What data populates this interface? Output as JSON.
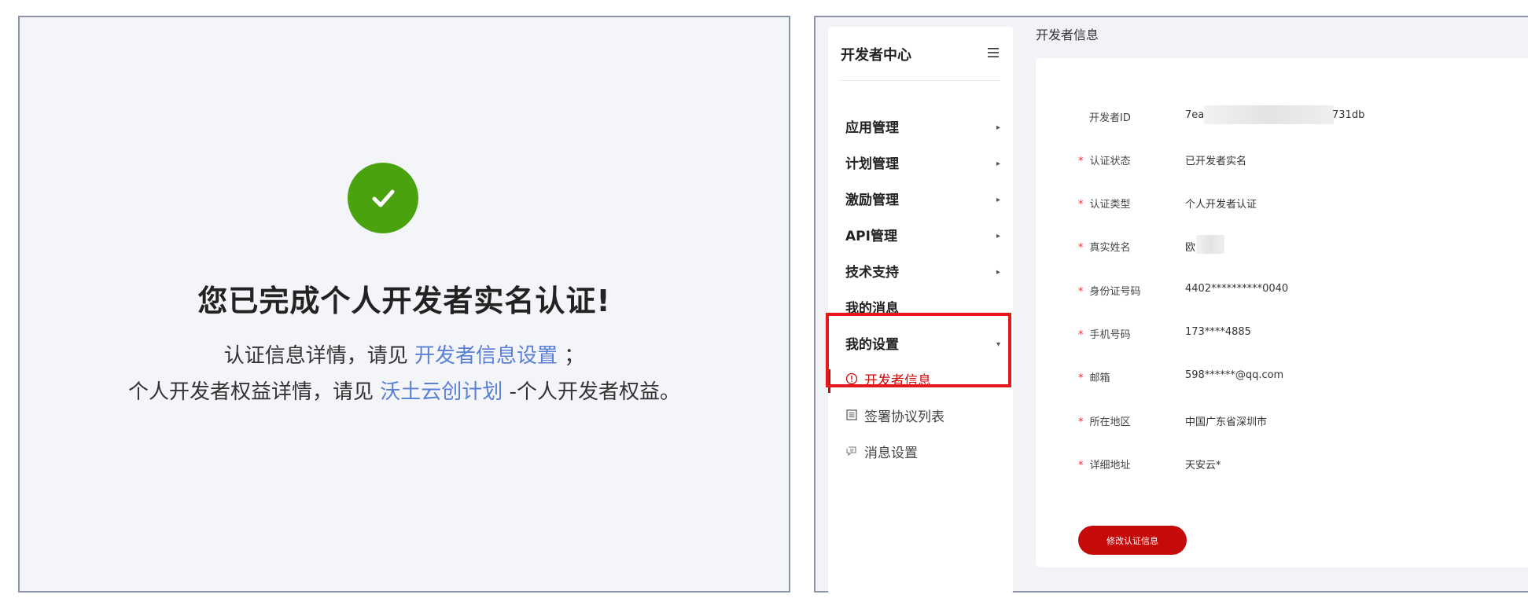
{
  "left": {
    "title": "您已完成个人开发者实名认证!",
    "line1_prefix": "认证信息详情，请见",
    "line1_link": "开发者信息设置",
    "line1_suffix": "；",
    "line2_prefix": "个人开发者权益详情，请见",
    "line2_link": "沃土云创计划",
    "line2_suffix": "-个人开发者权益。",
    "success_color": "#4aa20f",
    "link_color": "#5a7fd6"
  },
  "sidebar": {
    "title": "开发者中心",
    "items": [
      {
        "label": "应用管理",
        "arrow": "▸"
      },
      {
        "label": "计划管理",
        "arrow": "▸"
      },
      {
        "label": "激励管理",
        "arrow": "▸"
      },
      {
        "label": "API管理",
        "arrow": "▸"
      },
      {
        "label": "技术支持",
        "arrow": "▸"
      },
      {
        "label": "我的消息",
        "arrow": ""
      },
      {
        "label": "我的设置",
        "arrow": "▾"
      }
    ],
    "sub_items": [
      {
        "label": "开发者信息",
        "icon": "info-circle-icon",
        "active": true
      },
      {
        "label": "签署协议列表",
        "icon": "document-list-icon",
        "active": false
      },
      {
        "label": "消息设置",
        "icon": "message-icon",
        "active": false
      }
    ],
    "active_color": "#cc0a0a",
    "highlight_color": "#e4181d"
  },
  "content": {
    "breadcrumb": "开发者信息",
    "fields": [
      {
        "label": "开发者ID",
        "value": "7ea",
        "value_tail": "731db",
        "required": false
      },
      {
        "label": "认证状态",
        "value": "已开发者实名",
        "required": true
      },
      {
        "label": "认证类型",
        "value": "个人开发者认证",
        "required": true
      },
      {
        "label": "真实姓名",
        "value": "欧",
        "required": true
      },
      {
        "label": "身份证号码",
        "value": "4402**********0040",
        "required": true
      },
      {
        "label": "手机号码",
        "value": "173****4885",
        "required": true
      },
      {
        "label": "邮箱",
        "value": "598******@qq.com",
        "required": true
      },
      {
        "label": "所在地区",
        "value": "中国广东省深圳市",
        "required": true
      },
      {
        "label": "详细地址",
        "value": "天安云*",
        "required": true
      }
    ],
    "required_mark": "*",
    "edit_button": "修改认证信息",
    "button_color": "#c50a0a"
  }
}
